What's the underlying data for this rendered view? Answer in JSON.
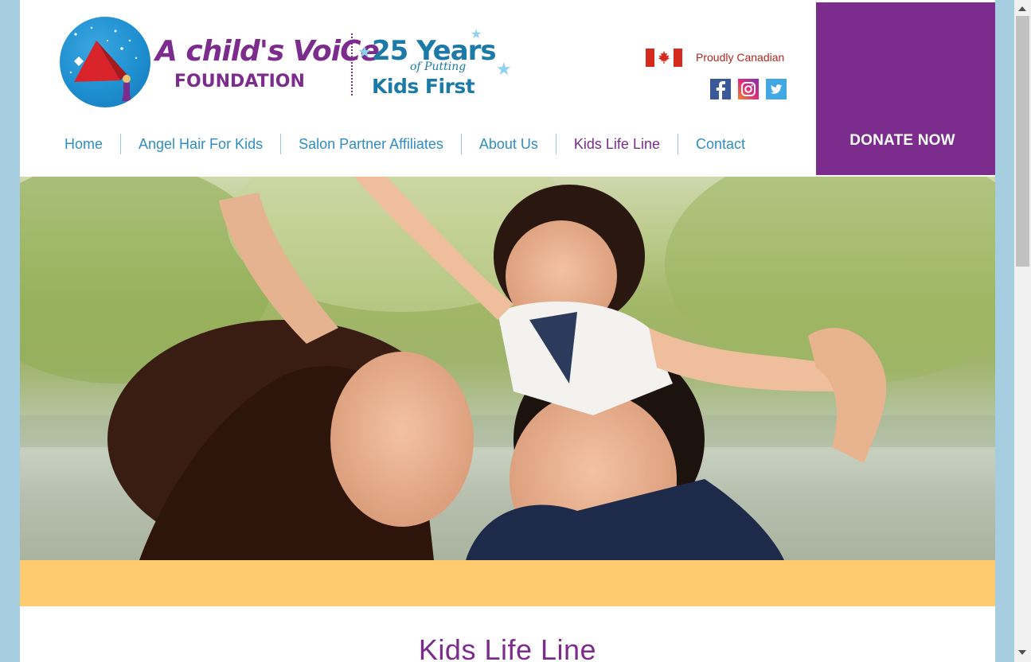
{
  "colors": {
    "brand_purple": "#7b2c8c",
    "nav_blue": "#2e8ec4",
    "band_yellow": "#fecb6e",
    "page_bg": "#a7cde0"
  },
  "logo": {
    "line1": "A child's VoiCe",
    "line2": "FOUNDATION",
    "years": "25 Years",
    "putting": "of Putting",
    "kids_first": "Kids First"
  },
  "topbar": {
    "country_text": "Proudly Canadian",
    "flag_icon": "canada-flag-icon",
    "social": [
      {
        "name": "facebook-icon",
        "glyph": "f"
      },
      {
        "name": "instagram-icon",
        "glyph": ""
      },
      {
        "name": "twitter-icon",
        "glyph": ""
      }
    ]
  },
  "nav": {
    "items": [
      {
        "label": "Home",
        "active": false
      },
      {
        "label": "Angel Hair For Kids",
        "active": false
      },
      {
        "label": "Salon Partner Affiliates",
        "active": false
      },
      {
        "label": "About Us",
        "active": false
      },
      {
        "label": "Kids Life Line",
        "active": true
      },
      {
        "label": "Contact",
        "active": false
      }
    ]
  },
  "donate": {
    "label": "DONATE NOW"
  },
  "hero": {
    "image": "family-photo"
  },
  "content": {
    "title": "Kids Life Line"
  }
}
